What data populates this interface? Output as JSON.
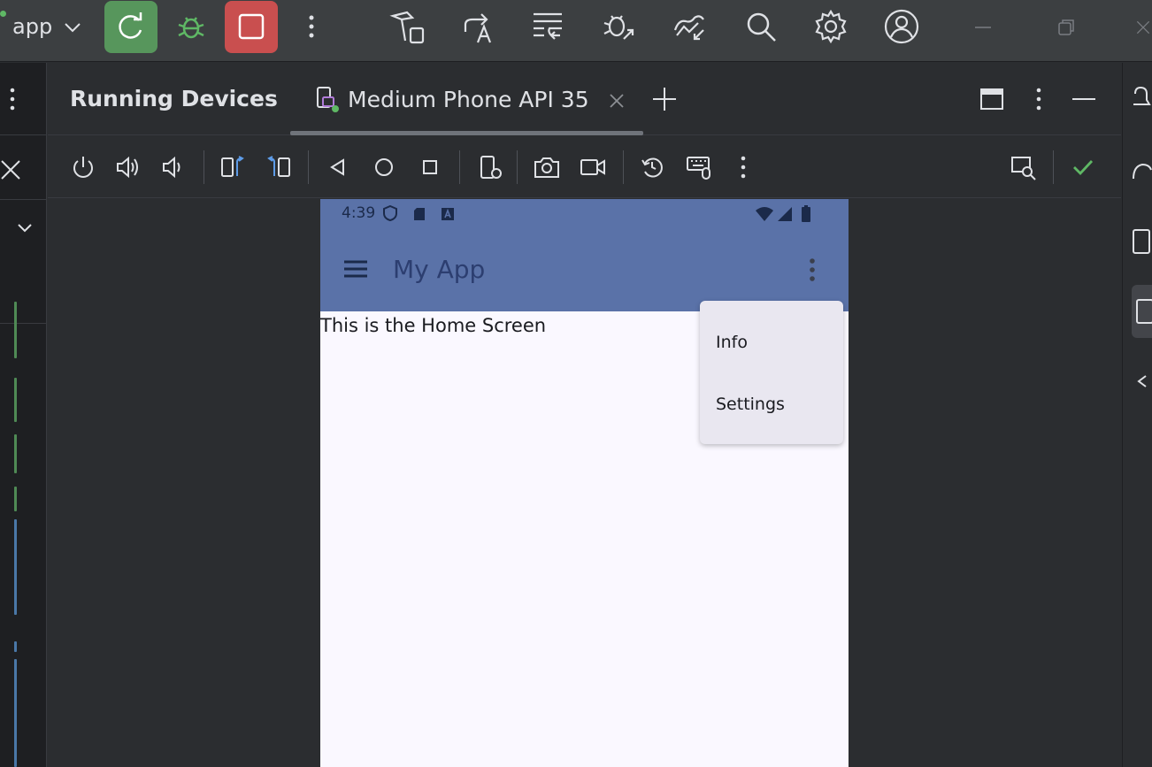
{
  "topbar": {
    "config_label": "app"
  },
  "panel": {
    "title": "Running Devices",
    "tab_label": "Medium Phone API 35"
  },
  "device": {
    "status_time": "4:39",
    "app_title": "My App",
    "screen_text": "This is the Home Screen",
    "menu": {
      "items": [
        "Info",
        "Settings"
      ]
    }
  },
  "colors": {
    "rerun": "#57965c",
    "stop": "#c94f4f",
    "appbar": "#5a72a8",
    "ok": "#5fb865"
  }
}
